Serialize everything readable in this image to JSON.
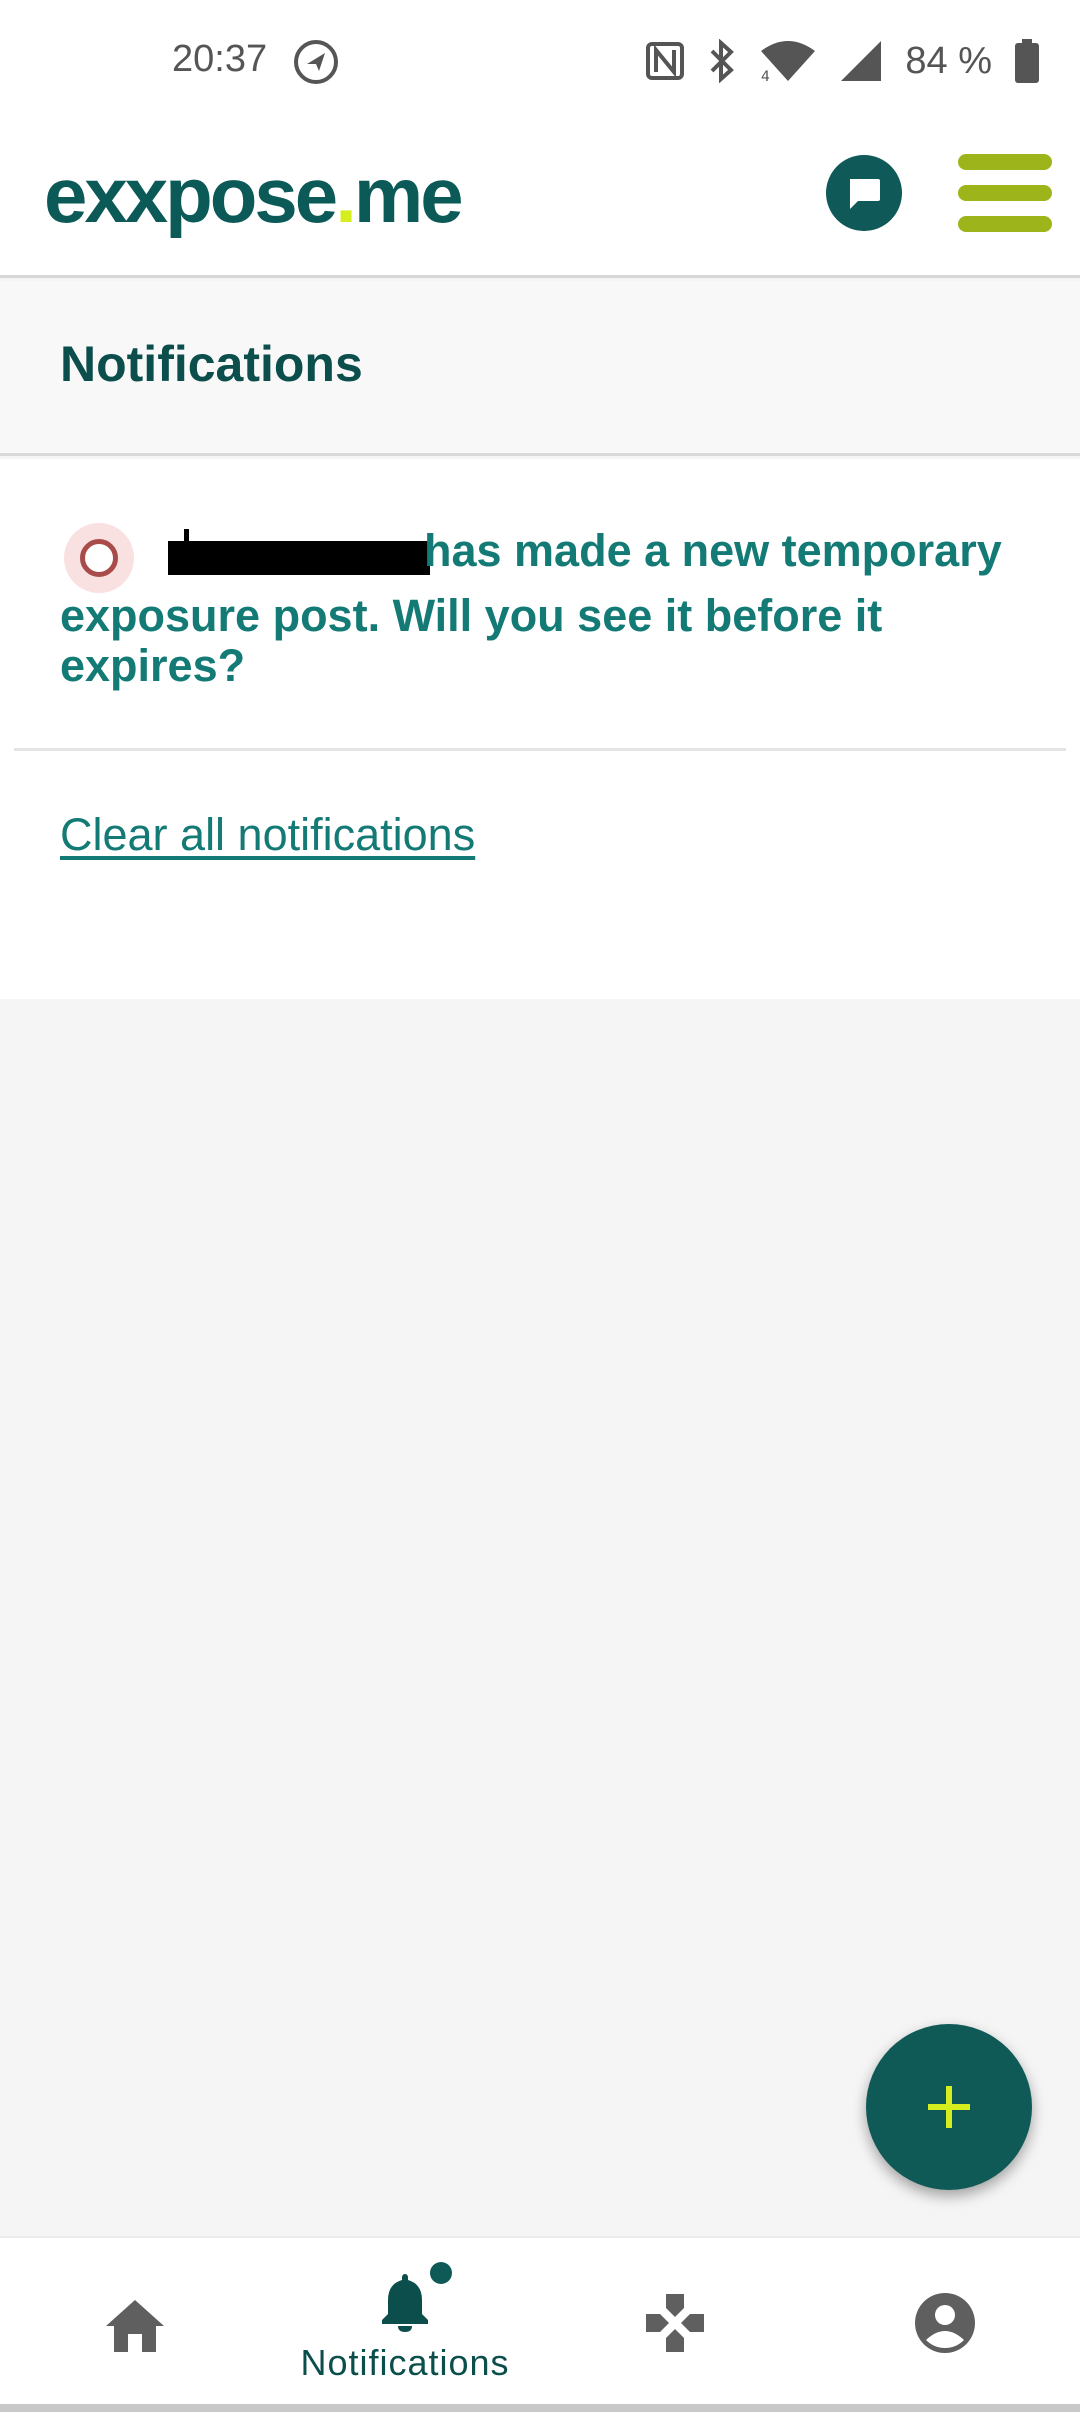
{
  "status_bar": {
    "time": "20:37",
    "battery": "84 %",
    "icons": [
      "navigation-icon",
      "nfc-icon",
      "bluetooth-icon",
      "wifi-icon",
      "signal-icon",
      "battery-icon"
    ]
  },
  "header": {
    "logo_main": "exxpose",
    "logo_dot": ".",
    "logo_suffix": "me",
    "chat_icon": "chat-bubble-icon",
    "menu_icon": "hamburger-menu-icon"
  },
  "section": {
    "title": "Notifications"
  },
  "notifications": [
    {
      "text_line1": "has made a new temporary",
      "text_rest": "exposure post. Will you see it before it expires?",
      "avatar_icon": "avatar-ring-icon"
    }
  ],
  "actions": {
    "clear_all": "Clear all notifications",
    "fab_icon": "plus-icon"
  },
  "bottom_nav": {
    "items": [
      {
        "icon": "home-icon",
        "label": ""
      },
      {
        "icon": "bell-icon",
        "label": "Notifications"
      },
      {
        "icon": "games-icon",
        "label": ""
      },
      {
        "icon": "account-icon",
        "label": ""
      }
    ]
  },
  "colors": {
    "brand_dark": "#0b5a57",
    "brand_text": "#137a75",
    "accent_lime": "#d6ee1d",
    "menu_green": "#9db51b"
  }
}
